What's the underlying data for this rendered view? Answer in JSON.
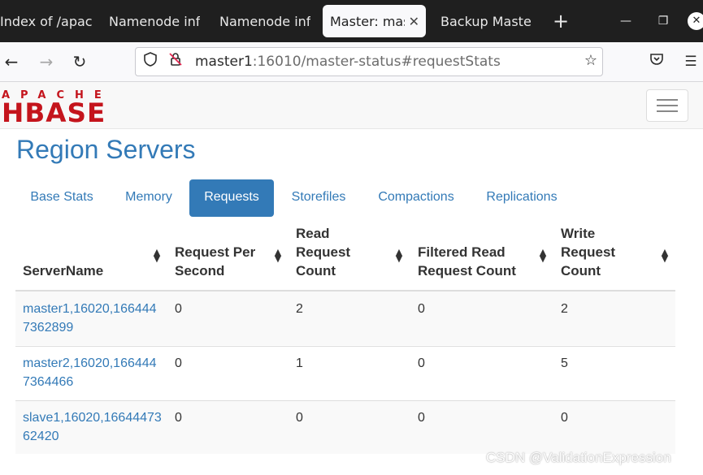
{
  "browser": {
    "tabs": [
      {
        "label": "Index of /apac"
      },
      {
        "label": "Namenode inf"
      },
      {
        "label": "Namenode inf"
      },
      {
        "label": "Master: mas",
        "active": true
      },
      {
        "label": "Backup Maste"
      }
    ],
    "new_tab_icon": "plus-icon",
    "window_controls": [
      "minimize-icon",
      "restore-icon",
      "close-icon"
    ],
    "url_host": "master1",
    "url_rest": ":16010/master-status#requestStats",
    "icons": [
      "back-icon",
      "forward-icon",
      "reload-icon",
      "shield-icon",
      "insecure-lock-icon",
      "star-icon",
      "pocket-icon",
      "menu-icon"
    ]
  },
  "hbase_nav": {
    "logo_top": "APACHE",
    "logo_bottom": "HBASE",
    "logo_color": "#c4141c"
  },
  "region_servers": {
    "title": "Region Servers",
    "tabs": [
      {
        "label": "Base Stats"
      },
      {
        "label": "Memory"
      },
      {
        "label": "Requests",
        "active": true
      },
      {
        "label": "Storefiles"
      },
      {
        "label": "Compactions"
      },
      {
        "label": "Replications"
      }
    ],
    "columns": [
      {
        "lines": [
          "ServerName"
        ]
      },
      {
        "lines": [
          "Request Per",
          "Second"
        ]
      },
      {
        "lines": [
          "Read",
          "Request",
          "Count"
        ]
      },
      {
        "lines": [
          "Filtered Read",
          "Request Count"
        ]
      },
      {
        "lines": [
          "Write",
          "Request",
          "Count"
        ]
      }
    ],
    "rows": [
      {
        "server": "master1,16020,1664447362899",
        "rps": "0",
        "read": "2",
        "filtered": "0",
        "write": "2"
      },
      {
        "server": "master2,16020,1664447364466",
        "rps": "0",
        "read": "1",
        "filtered": "0",
        "write": "5"
      },
      {
        "server": "slave1,16020,1664447362420",
        "rps": "0",
        "read": "0",
        "filtered": "0",
        "write": "0"
      }
    ]
  },
  "watermark": "CSDN @ValidationExpression",
  "accent_color": "#337ab7"
}
